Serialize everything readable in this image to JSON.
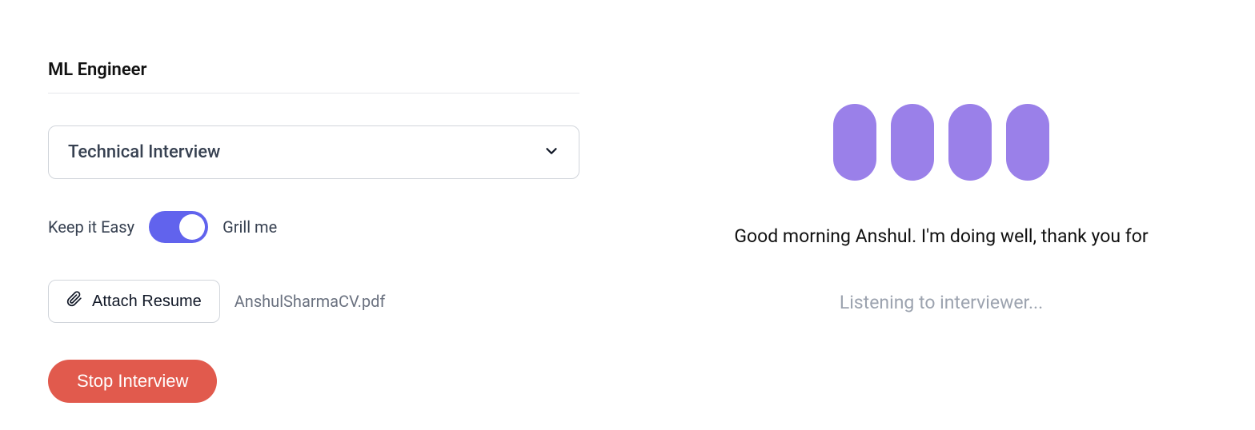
{
  "form": {
    "role_title": "ML Engineer",
    "interview_type": "Technical Interview",
    "difficulty": {
      "left_label": "Keep it Easy",
      "right_label": "Grill me"
    },
    "attach": {
      "button_label": "Attach Resume",
      "filename": "AnshulSharmaCV.pdf"
    },
    "stop_button_label": "Stop Interview"
  },
  "conversation": {
    "transcript": "Good morning Anshul. I'm doing well, thank you for",
    "status": "Listening to interviewer..."
  },
  "colors": {
    "accent_purple": "#9a80e9",
    "toggle_blue": "#6163ed",
    "stop_red": "#e15a4d"
  }
}
